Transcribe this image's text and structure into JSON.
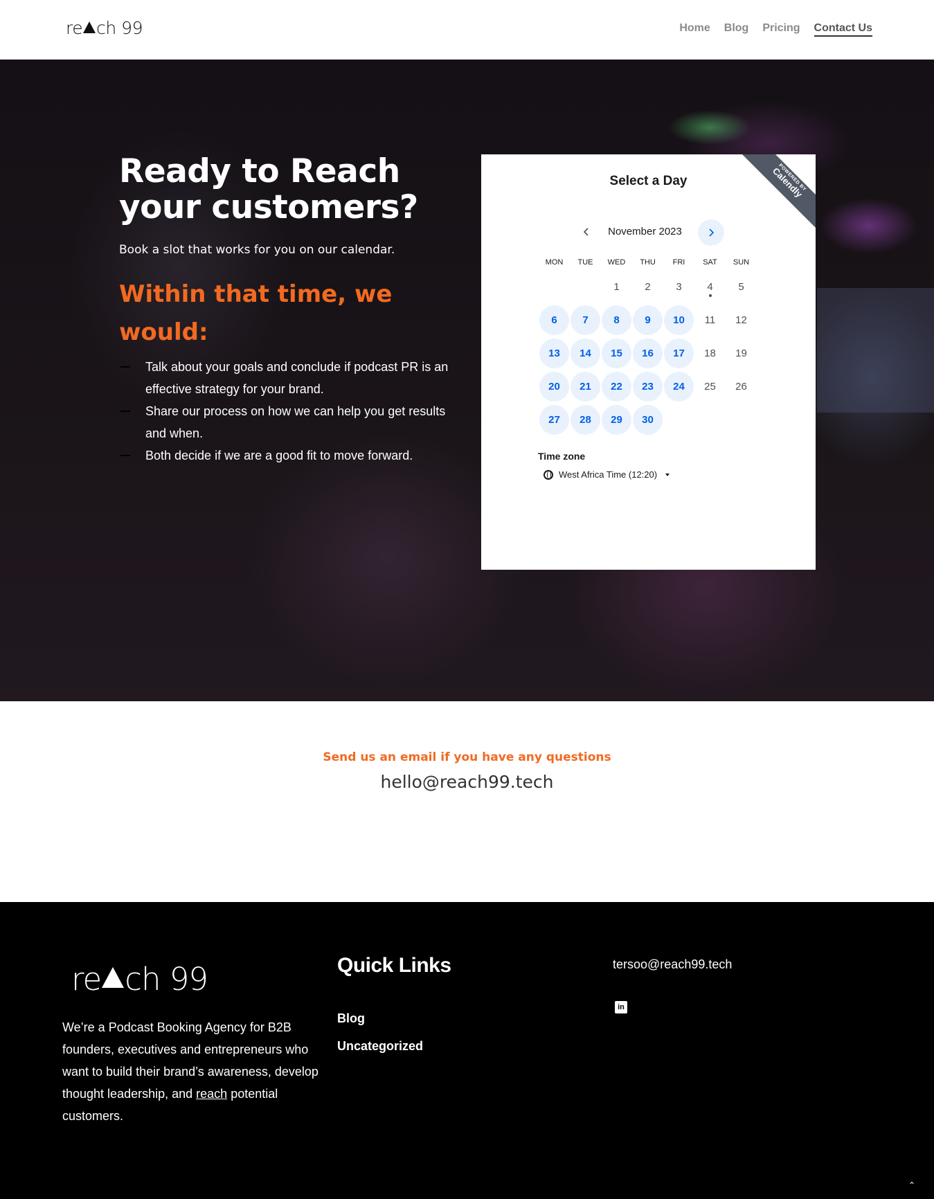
{
  "header": {
    "logo_left": "re",
    "logo_right": "ch 99",
    "nav": [
      {
        "label": "Home"
      },
      {
        "label": "Blog"
      },
      {
        "label": "Pricing"
      },
      {
        "label": "Contact Us"
      }
    ]
  },
  "hero": {
    "title": "Ready to Reach your customers?",
    "subtitle": "Book a slot that works for you on our calendar.",
    "orange_heading": "Within that time, we would:",
    "bullets": [
      "Talk about your goals and conclude if podcast PR is an effective strategy for your brand.",
      "Share our process on how we can help you get results and when.",
      "Both decide if we are a good fit to move forward."
    ]
  },
  "calendar": {
    "ribbon_small": "POWERED BY",
    "ribbon_big": "Calendly",
    "title": "Select a Day",
    "month": "November 2023",
    "prev_icon": "chevron-left-icon",
    "next_icon": "chevron-right-icon",
    "weekdays": [
      "MON",
      "TUE",
      "WED",
      "THU",
      "FRI",
      "SAT",
      "SUN"
    ],
    "days": [
      {
        "n": "",
        "a": false
      },
      {
        "n": "",
        "a": false
      },
      {
        "n": "1",
        "a": false
      },
      {
        "n": "2",
        "a": false
      },
      {
        "n": "3",
        "a": false
      },
      {
        "n": "4",
        "a": false,
        "today": true
      },
      {
        "n": "5",
        "a": false
      },
      {
        "n": "6",
        "a": true
      },
      {
        "n": "7",
        "a": true
      },
      {
        "n": "8",
        "a": true
      },
      {
        "n": "9",
        "a": true
      },
      {
        "n": "10",
        "a": true
      },
      {
        "n": "11",
        "a": false
      },
      {
        "n": "12",
        "a": false
      },
      {
        "n": "13",
        "a": true
      },
      {
        "n": "14",
        "a": true
      },
      {
        "n": "15",
        "a": true
      },
      {
        "n": "16",
        "a": true
      },
      {
        "n": "17",
        "a": true
      },
      {
        "n": "18",
        "a": false
      },
      {
        "n": "19",
        "a": false
      },
      {
        "n": "20",
        "a": true
      },
      {
        "n": "21",
        "a": true
      },
      {
        "n": "22",
        "a": true
      },
      {
        "n": "23",
        "a": true
      },
      {
        "n": "24",
        "a": true
      },
      {
        "n": "25",
        "a": false
      },
      {
        "n": "26",
        "a": false
      },
      {
        "n": "27",
        "a": true
      },
      {
        "n": "28",
        "a": true
      },
      {
        "n": "29",
        "a": true
      },
      {
        "n": "30",
        "a": true
      }
    ],
    "timezone_label": "Time zone",
    "timezone_value": "West Africa Time (12:20)",
    "accent": "#0060e6",
    "available_bg": "#e9f1fd"
  },
  "email_section": {
    "question": "Send us an email if you have any questions",
    "address": "hello@reach99.tech",
    "accent": "#f26a21"
  },
  "footer": {
    "logo_left": "re",
    "logo_right": "ch 99",
    "about_before": "We’re a Podcast Booking Agency for B2B founders, executives and entrepreneurs who want to build their brand’s awareness, develop thought leadership, and ",
    "about_link": "reach",
    "about_after": " potential customers.",
    "quick_links_title": "Quick Links",
    "links": [
      "Blog",
      "Uncategorized"
    ],
    "contact_email": "tersoo@reach99.tech",
    "social_icon": "linkedin-icon",
    "social_glyph": "in",
    "to_top_glyph": "⌃"
  }
}
